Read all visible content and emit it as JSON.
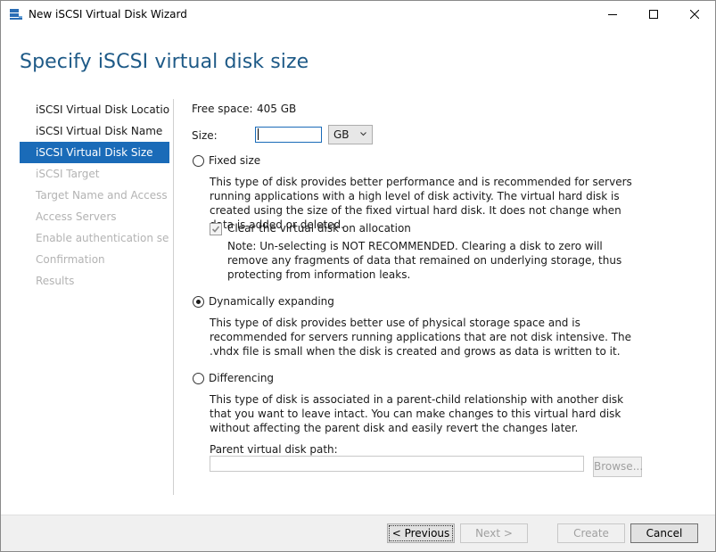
{
  "window": {
    "title": "New iSCSI Virtual Disk Wizard",
    "controls": [
      "minimize-icon",
      "maximize-icon",
      "close-icon"
    ]
  },
  "page": {
    "heading": "Specify iSCSI virtual disk size"
  },
  "steps": [
    {
      "label": "iSCSI Virtual Disk Location",
      "state": "done"
    },
    {
      "label": "iSCSI Virtual Disk Name",
      "state": "done"
    },
    {
      "label": "iSCSI Virtual Disk Size",
      "state": "active"
    },
    {
      "label": "iSCSI Target",
      "state": "disabled"
    },
    {
      "label": "Target Name and Access",
      "state": "disabled"
    },
    {
      "label": "Access Servers",
      "state": "disabled"
    },
    {
      "label": "Enable authentication ser...",
      "state": "disabled"
    },
    {
      "label": "Confirmation",
      "state": "disabled"
    },
    {
      "label": "Results",
      "state": "disabled"
    }
  ],
  "form": {
    "free_space_label": "Free space:",
    "free_space_value": "405 GB",
    "size_label": "Size:",
    "size_value": "",
    "unit_value": "GB",
    "fixed": {
      "label": "Fixed size",
      "selected": false,
      "description": "This type of disk provides better performance and is recommended for servers running applications with a high level of disk activity. The virtual hard disk is created using the size of the fixed virtual hard disk. It does not change when data is added or deleted.",
      "clear_checkbox_label": "Clear the virtual disk on allocation",
      "clear_checked": true,
      "note": "Note: Un-selecting is NOT RECOMMENDED. Clearing a disk to zero will remove any fragments of data that remained on underlying storage, thus protecting from information leaks."
    },
    "dynamic": {
      "label": "Dynamically expanding",
      "selected": true,
      "description": "This type of disk provides better use of physical storage space and is recommended for servers running applications that are not disk intensive. The .vhdx file is small when the disk is created and grows as data is written to it."
    },
    "differencing": {
      "label": "Differencing",
      "selected": false,
      "description": "This type of disk is associated in a parent-child relationship with another disk that you want to leave intact. You can make changes to this virtual hard disk without affecting the parent disk and easily revert the changes later.",
      "parent_path_label": "Parent virtual disk path:",
      "parent_path_value": "",
      "browse_label": "Browse..."
    }
  },
  "footer": {
    "previous_label": "< Previous",
    "next_label": "Next >",
    "create_label": "Create",
    "cancel_label": "Cancel"
  },
  "colors": {
    "heading": "#1e5a87",
    "active_step": "#1a6bb8",
    "disabled_text": "#b3b3b3"
  }
}
